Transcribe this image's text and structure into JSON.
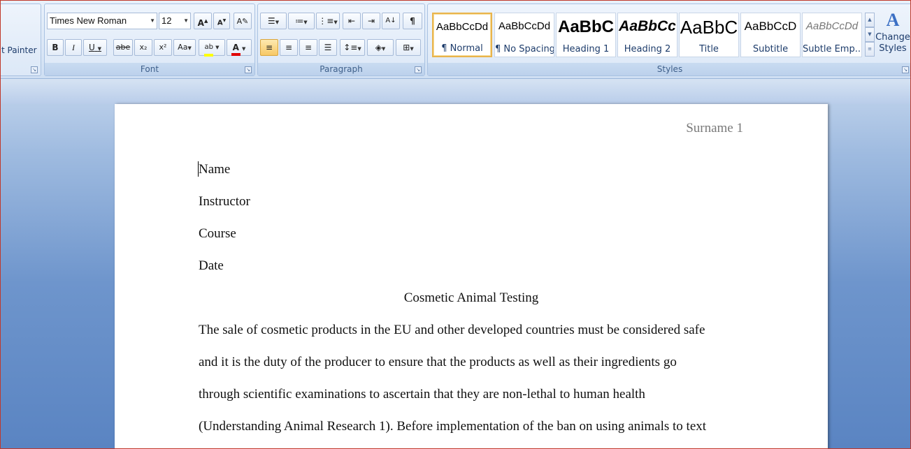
{
  "ribbon": {
    "clipboard": {
      "format_painter_label": "t Painter"
    },
    "font": {
      "group_label": "Font",
      "font_name": "Times New Roman",
      "font_size": "12",
      "grow_label": "A",
      "shrink_label": "A",
      "bold": "B",
      "italic": "I",
      "underline": "U",
      "strikethrough": "abe",
      "subscript": "x₂",
      "superscript": "x²",
      "change_case": "Aa",
      "highlight_label": "ab",
      "font_color_label": "A",
      "highlight_color": "#ffff00",
      "font_color": "#e00000"
    },
    "paragraph": {
      "group_label": "Paragraph",
      "sort_label": "A↓",
      "show_marks": "¶"
    },
    "styles": {
      "group_label": "Styles",
      "tiles": [
        {
          "sample": "AaBbCcDd",
          "name": "¶ Normal"
        },
        {
          "sample": "AaBbCcDd",
          "name": "¶ No Spacing"
        },
        {
          "sample": "AaBbC",
          "name": "Heading 1"
        },
        {
          "sample": "AaBbCc",
          "name": "Heading 2"
        },
        {
          "sample": "AaBbC",
          "name": "Title"
        },
        {
          "sample": "AaBbCcD",
          "name": "Subtitle"
        },
        {
          "sample": "AaBbCcDd",
          "name": "Subtle Emp..."
        }
      ],
      "change_styles_line1": "Change",
      "change_styles_line2": "Styles"
    }
  },
  "document": {
    "header": "Surname 1",
    "lines": [
      "Name",
      "Instructor",
      "Course",
      "Date"
    ],
    "title": "Cosmetic Animal Testing",
    "body": [
      "The sale of cosmetic products in the EU and other developed countries must be considered safe",
      "and it is the duty of the producer to ensure that the products as well as their ingredients go",
      "through scientific examinations to ascertain that they are non-lethal to human health",
      "(Understanding Animal Research 1). Before implementation of the ban on using animals to text"
    ]
  }
}
